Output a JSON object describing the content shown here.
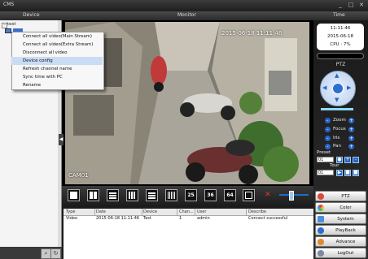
{
  "window": {
    "title": "CMS",
    "minimize": "_",
    "restore": "□",
    "close": "✕"
  },
  "header": {
    "device": "Device",
    "monitor": "Monitor",
    "time": "Time"
  },
  "device_tree": {
    "root": "test"
  },
  "context_menu": {
    "items": [
      "Connect all video(Main Stream)",
      "Connect all video(Extra Stream)",
      "Disconnect all video",
      "Device config",
      "Refresh channel name",
      "Sync time with PC",
      "Rename"
    ],
    "selected_index": 3
  },
  "video": {
    "osd_time": "2015-06-18 11:11:46",
    "camera_label": "CAM01"
  },
  "layout_bar": {
    "numbered": [
      "25",
      "36",
      "64"
    ]
  },
  "log": {
    "columns": [
      "Type",
      "Date",
      "Device",
      "Chan...",
      "User",
      "Describe"
    ],
    "rows": [
      {
        "type": "Video",
        "date": "2015-06-18 11:11:46",
        "device": "Test",
        "channel": "1",
        "user": "admin",
        "describe": "Connect successful"
      }
    ]
  },
  "clock": {
    "time": "11:11:46",
    "date": "2015-06-18",
    "cpu": "CPU : 7%"
  },
  "ptz": {
    "title": "PTZ",
    "controls": [
      "Zoom",
      "Focus",
      "Iris",
      "Pan"
    ],
    "preset_label": "Preset",
    "preset_value": "01",
    "tour_label": "Tour",
    "tour_value": "01"
  },
  "menu": {
    "buttons": [
      {
        "label": "PTZ",
        "icon": "ptz-icon",
        "color": "#d94a3d"
      },
      {
        "label": "Color",
        "icon": "color-icon",
        "color": "#3a9bd9"
      },
      {
        "label": "System",
        "icon": "system-icon",
        "color": "#4a90e2"
      },
      {
        "label": "PlayBack",
        "icon": "playback-icon",
        "color": "#2a6fd0"
      },
      {
        "label": "Advance",
        "icon": "advance-icon",
        "color": "#e08a2c"
      },
      {
        "label": "LogOut",
        "icon": "logout-icon",
        "color": "#7a8aa0"
      }
    ]
  },
  "colors": {
    "accent": "#2766c9",
    "selection": "#c9dcf3"
  }
}
